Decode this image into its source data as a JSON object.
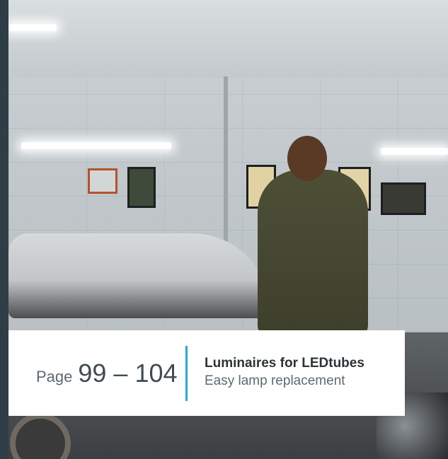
{
  "caption": {
    "page_label": "Page",
    "page_range": "99 – 104",
    "title": "Luminaires for LEDtubes",
    "subtitle": "Easy lamp replacement"
  },
  "colors": {
    "frame": "#2f3e46",
    "accent": "#29a8d8",
    "caption_background": "#ffffff",
    "text_dark": "#2d3336",
    "text_muted": "#5d6a72"
  }
}
